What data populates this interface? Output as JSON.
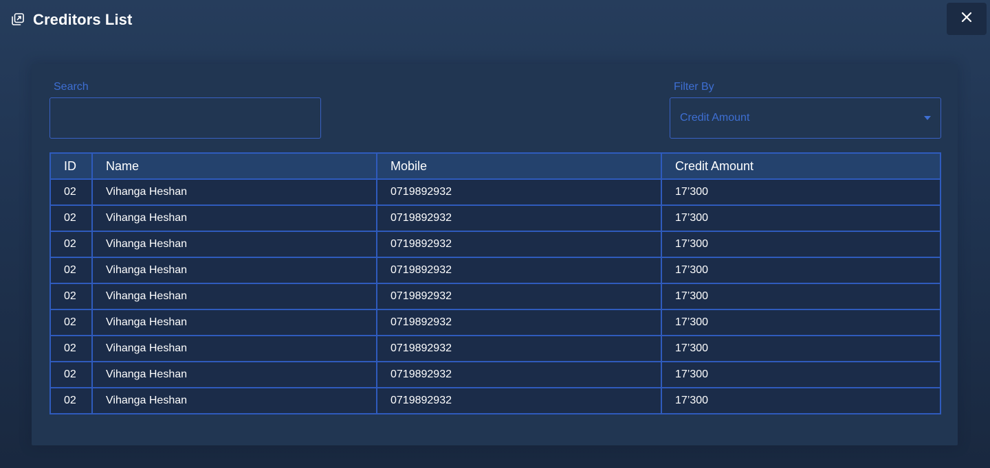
{
  "window": {
    "title": "Creditors List",
    "title_icon": "external-window-icon",
    "close_icon": "close-icon"
  },
  "search": {
    "label": "Search",
    "value": "",
    "placeholder": ""
  },
  "filter": {
    "label": "Filter By",
    "selected": "Credit Amount",
    "icon": "chevron-down-icon"
  },
  "table": {
    "columns": [
      "ID",
      "Name",
      "Mobile",
      "Credit Amount"
    ],
    "rows": [
      {
        "id": "02",
        "name": "Vihanga Heshan",
        "mobile": "0719892932",
        "credit": "17’300"
      },
      {
        "id": "02",
        "name": "Vihanga Heshan",
        "mobile": "0719892932",
        "credit": "17’300"
      },
      {
        "id": "02",
        "name": "Vihanga Heshan",
        "mobile": "0719892932",
        "credit": "17’300"
      },
      {
        "id": "02",
        "name": "Vihanga Heshan",
        "mobile": "0719892932",
        "credit": "17’300"
      },
      {
        "id": "02",
        "name": "Vihanga Heshan",
        "mobile": "0719892932",
        "credit": "17’300"
      },
      {
        "id": "02",
        "name": "Vihanga Heshan",
        "mobile": "0719892932",
        "credit": "17’300"
      },
      {
        "id": "02",
        "name": "Vihanga Heshan",
        "mobile": "0719892932",
        "credit": "17’300"
      },
      {
        "id": "02",
        "name": "Vihanga Heshan",
        "mobile": "0719892932",
        "credit": "17’300"
      },
      {
        "id": "02",
        "name": "Vihanga Heshan",
        "mobile": "0719892932",
        "credit": "17’300"
      }
    ]
  },
  "colors": {
    "background": "#1f3350",
    "panel": "#213652",
    "accent": "#3e6fd3",
    "border": "#2f5bbd",
    "header_row": "#24426d",
    "body_row": "#1b2c49",
    "close_button": "#1b2b44"
  }
}
